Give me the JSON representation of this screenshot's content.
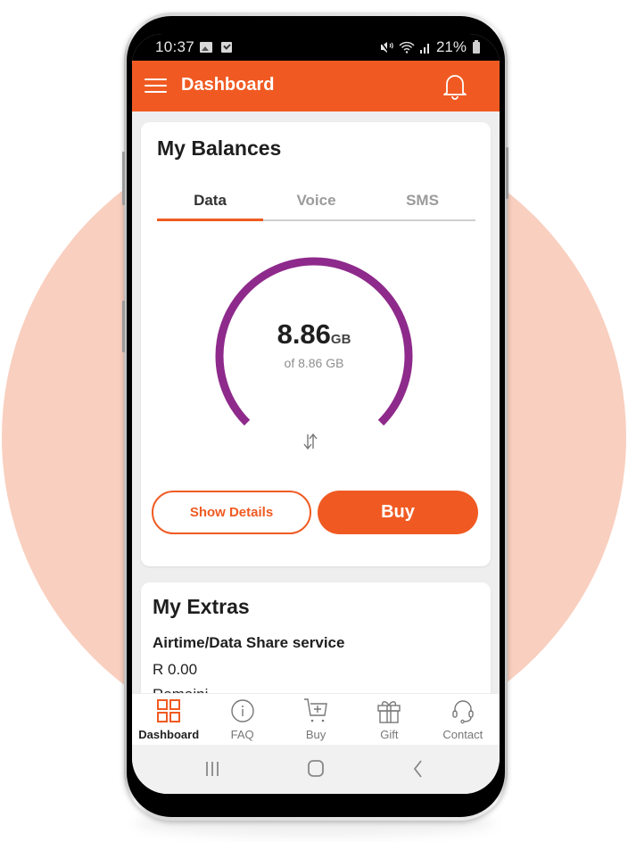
{
  "status_bar": {
    "time": "10:37",
    "left_icons": [
      "image-notification-icon",
      "checkbox-notification-icon"
    ],
    "right_icons": [
      "mute-icon",
      "wifi-icon",
      "signal-icon"
    ],
    "battery": "21%"
  },
  "app_bar": {
    "title": "Dashboard",
    "menu_icon": "hamburger-menu-icon",
    "notification_icon": "bell-icon"
  },
  "balances": {
    "title": "My Balances",
    "tabs": [
      {
        "label": "Data",
        "active": true
      },
      {
        "label": "Voice",
        "active": false
      },
      {
        "label": "SMS",
        "active": false
      }
    ],
    "gauge": {
      "value": "8.86",
      "unit": "GB",
      "total_text": "of 8.86 GB",
      "fraction_remaining": 1.0,
      "color": "#8e2a8b"
    },
    "swap_icon": "swap-vertical-icon",
    "show_details_label": "Show Details",
    "buy_label": "Buy"
  },
  "extras": {
    "title": "My Extras",
    "service_name": "Airtime/Data Share service",
    "amount": "R 0.00",
    "next_line_partial": "Remaini"
  },
  "bottom_nav": {
    "items": [
      {
        "label": "Dashboard",
        "icon": "grid-icon",
        "active": true
      },
      {
        "label": "FAQ",
        "icon": "info-icon",
        "active": false
      },
      {
        "label": "Buy",
        "icon": "cart-add-icon",
        "active": false
      },
      {
        "label": "Gift",
        "icon": "gift-icon",
        "active": false
      },
      {
        "label": "Contact",
        "icon": "headset-icon",
        "active": false
      }
    ]
  },
  "system_nav": {
    "buttons": [
      "recent-apps-icon",
      "home-icon",
      "back-icon"
    ]
  },
  "colors": {
    "brand": "#f05a22",
    "gauge": "#8e2a8b",
    "backdrop": "#f9cfbf"
  }
}
